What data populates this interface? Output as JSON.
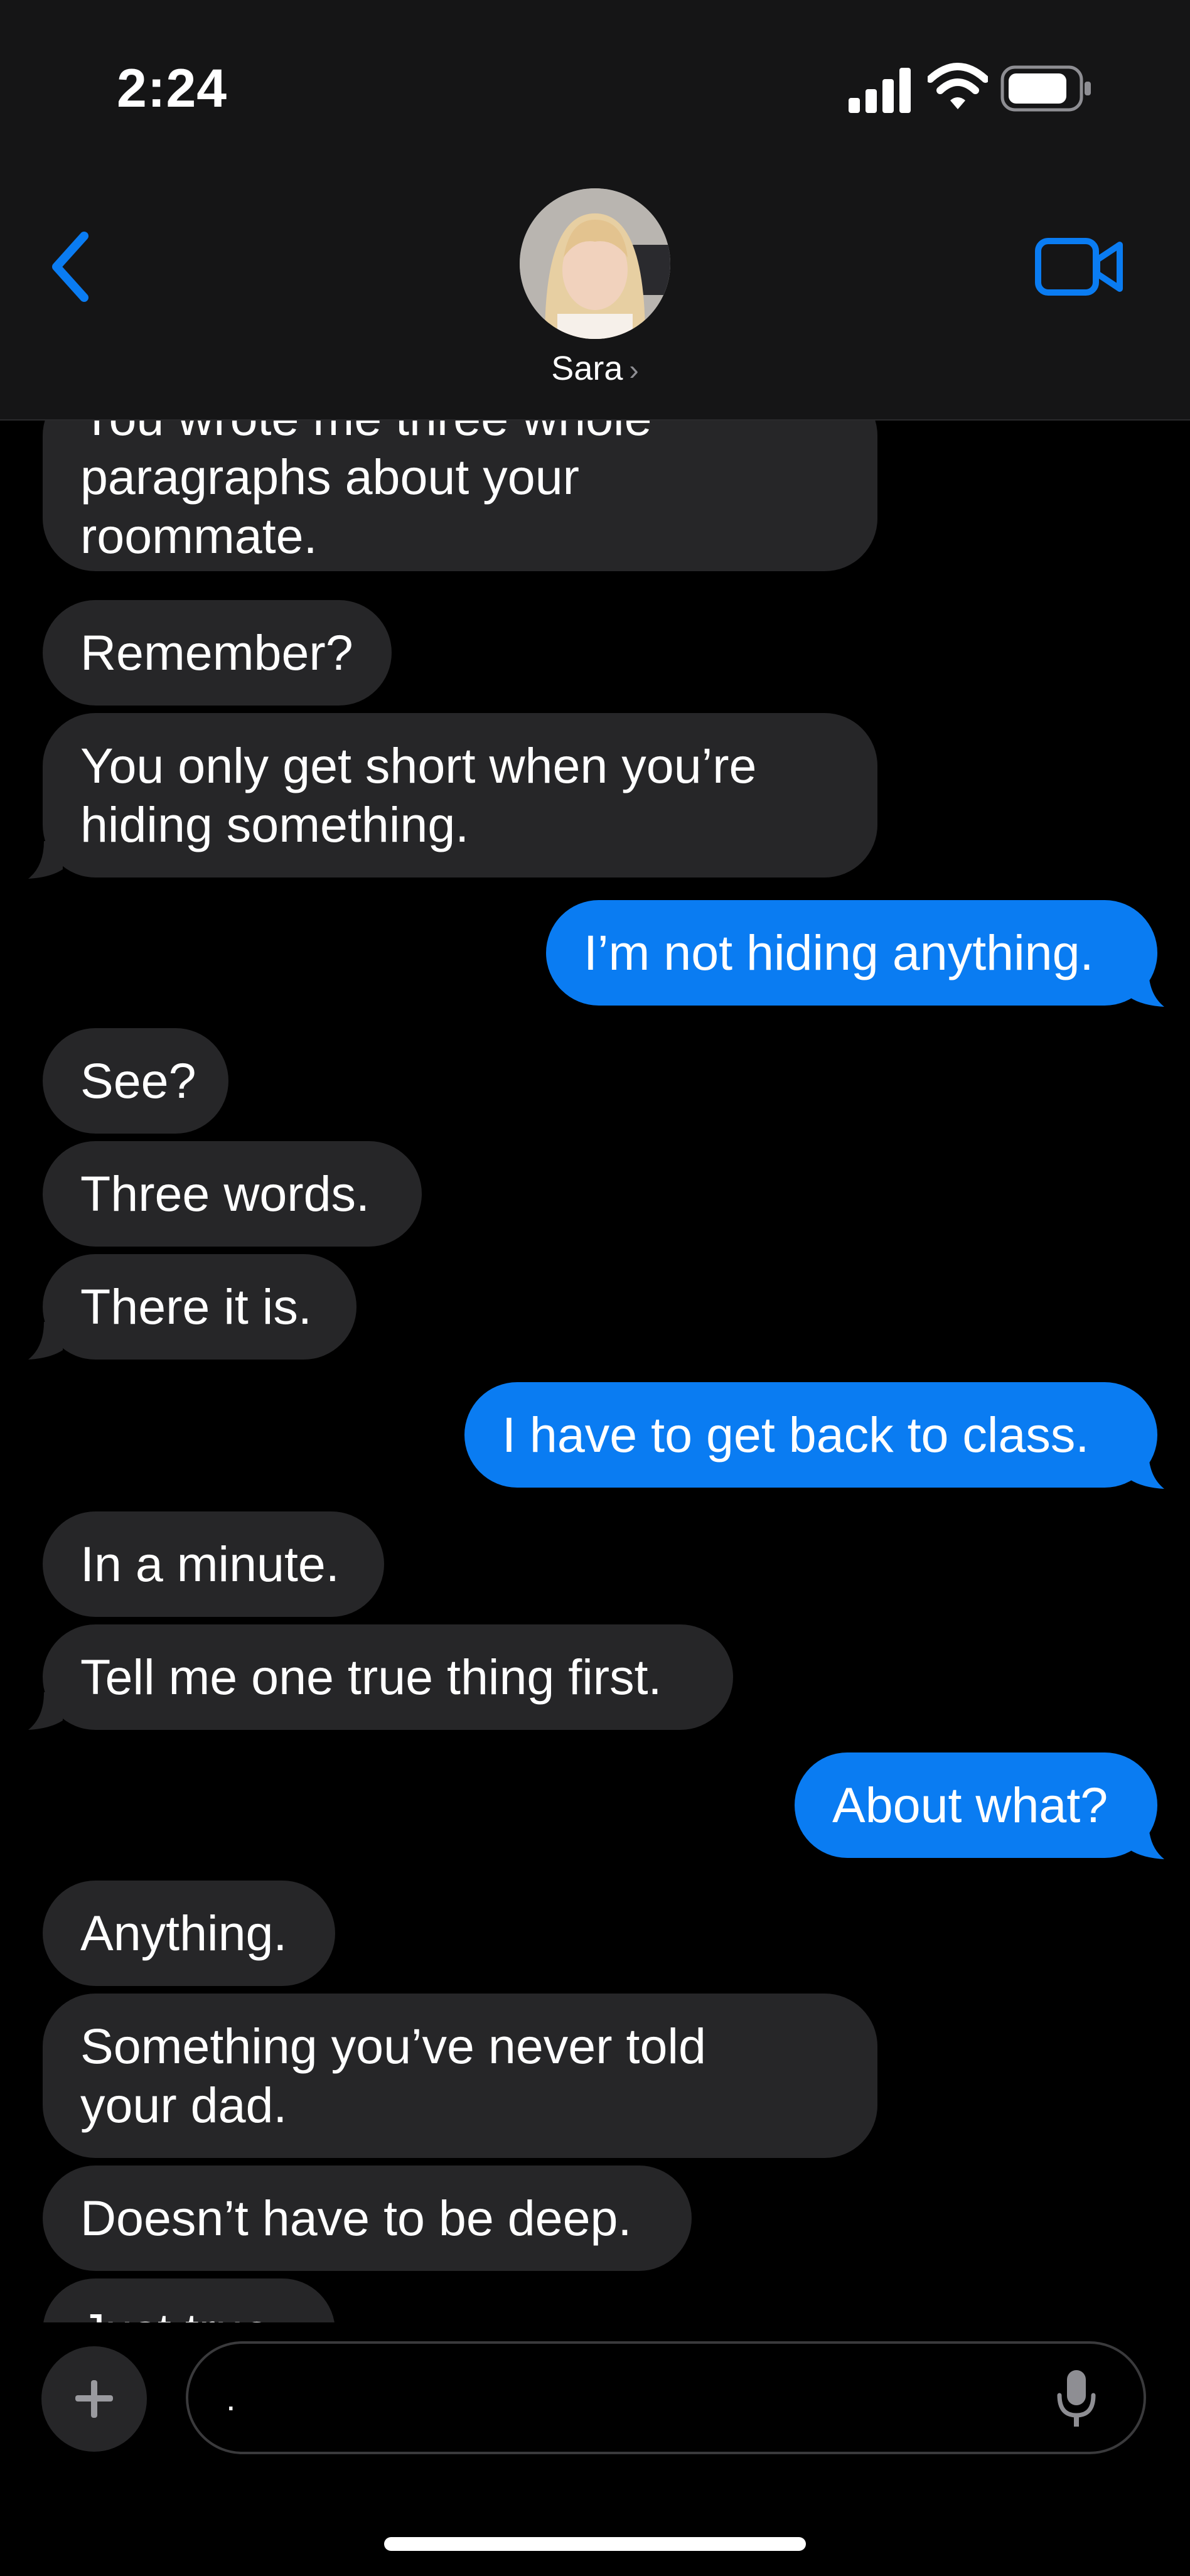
{
  "status_bar": {
    "time": "2:24"
  },
  "header": {
    "contact_name": "Sara"
  },
  "messages": [
    {
      "from": "them",
      "text": "You wrote me three whole\nparagraphs about your\nroommate."
    },
    {
      "from": "them",
      "text": "Remember?"
    },
    {
      "from": "them",
      "text": "You only get short when you’re\nhiding something."
    },
    {
      "from": "me",
      "text": "I’m not hiding anything."
    },
    {
      "from": "them",
      "text": "See?"
    },
    {
      "from": "them",
      "text": "Three words."
    },
    {
      "from": "them",
      "text": "There it is."
    },
    {
      "from": "me",
      "text": "I have to get back to class."
    },
    {
      "from": "them",
      "text": "In a minute."
    },
    {
      "from": "them",
      "text": "Tell me one true thing first."
    },
    {
      "from": "me",
      "text": "About what?"
    },
    {
      "from": "them",
      "text": "Anything."
    },
    {
      "from": "them",
      "text": "Something you’ve never told\nyour dad."
    },
    {
      "from": "them",
      "text": "Doesn’t have to be deep."
    },
    {
      "from": "them",
      "text": "Just true."
    }
  ],
  "composer": {
    "value": "."
  },
  "colors": {
    "outgoing": "#0a7cf2",
    "incoming": "#262628",
    "accent": "#0a7cf2"
  }
}
